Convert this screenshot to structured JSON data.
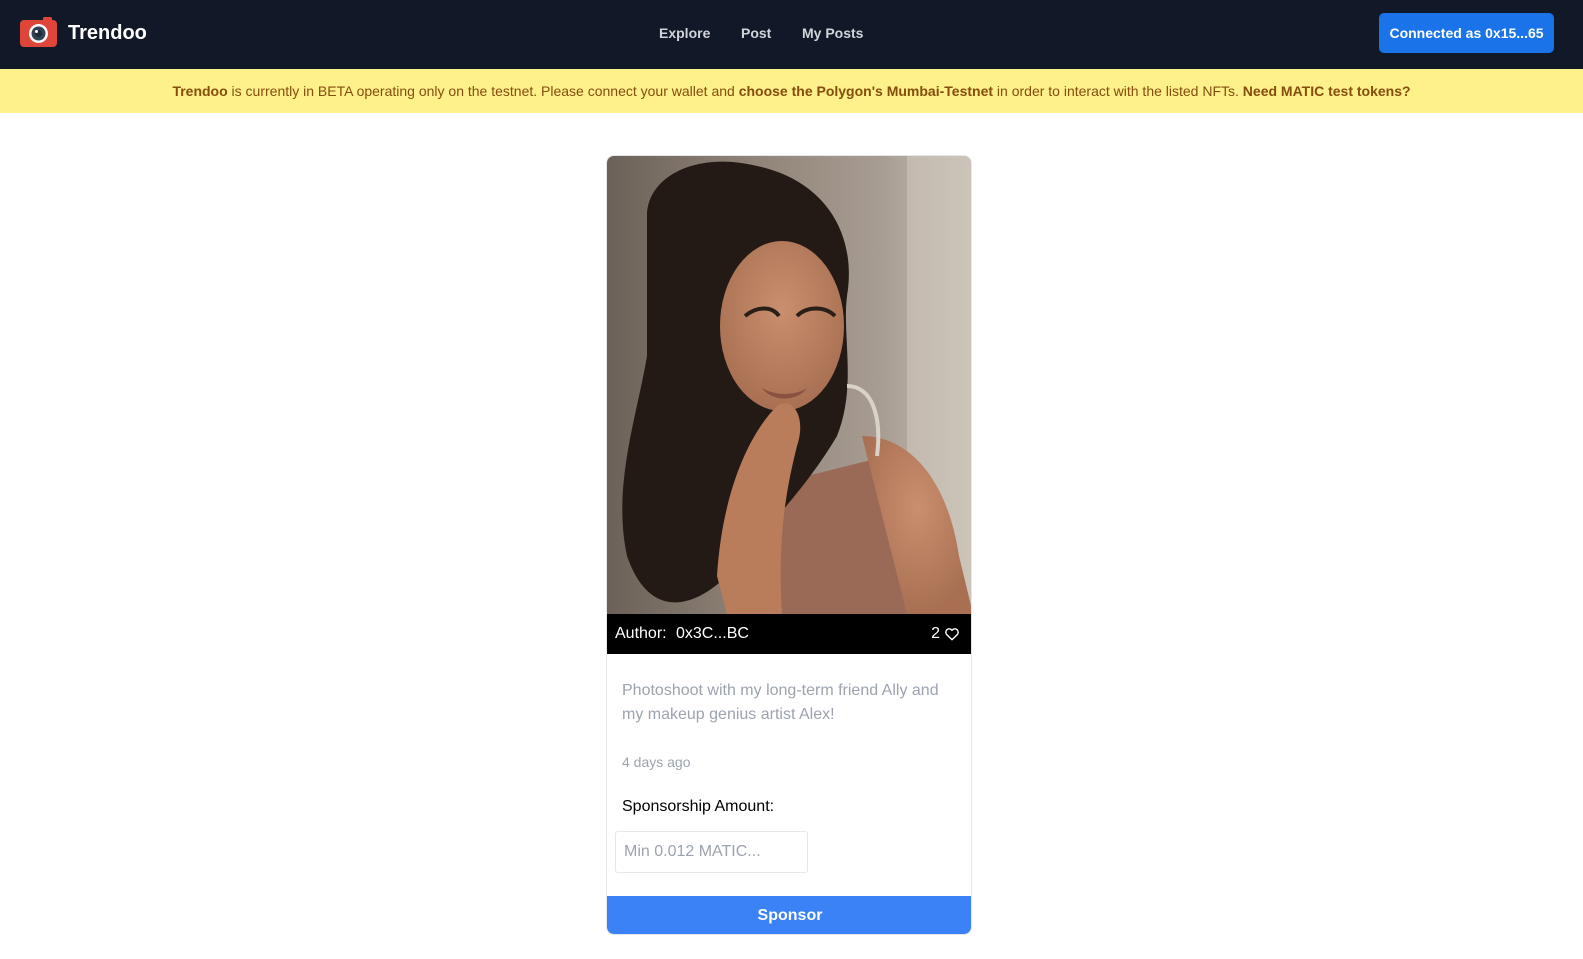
{
  "app": {
    "brand": "Trendoo",
    "logo_icon": "camera-icon",
    "colors": {
      "navbar": "#111827",
      "accent": "#1a73e8",
      "banner_bg": "#fef08a",
      "banner_text": "#854d0e",
      "sponsor_button": "#3b82f6"
    }
  },
  "nav": {
    "links": [
      {
        "label": "Explore"
      },
      {
        "label": "Post"
      },
      {
        "label": "My Posts"
      }
    ],
    "connect_label": "Connected as 0x15...65"
  },
  "banner": {
    "brand": "Trendoo",
    "text1": " is currently in BETA operating only on the testnet. Please connect your wallet and ",
    "bold1": "choose the Polygon's Mumbai-Testnet",
    "text2": " in order to interact with the listed NFTs. ",
    "link": "Need MATIC test tokens?"
  },
  "post": {
    "author_label": "Author:",
    "author": "0x3C...BC",
    "likes": "2",
    "like_icon": "heart-icon",
    "description": "Photoshoot with my long-term friend Ally and my makeup genius artist Alex!",
    "time": "4 days ago",
    "sponsorship_label": "Sponsorship Amount:",
    "amount_placeholder": "Min 0.012 MATIC...",
    "amount_value": "",
    "sponsor_label": "Sponsor"
  }
}
